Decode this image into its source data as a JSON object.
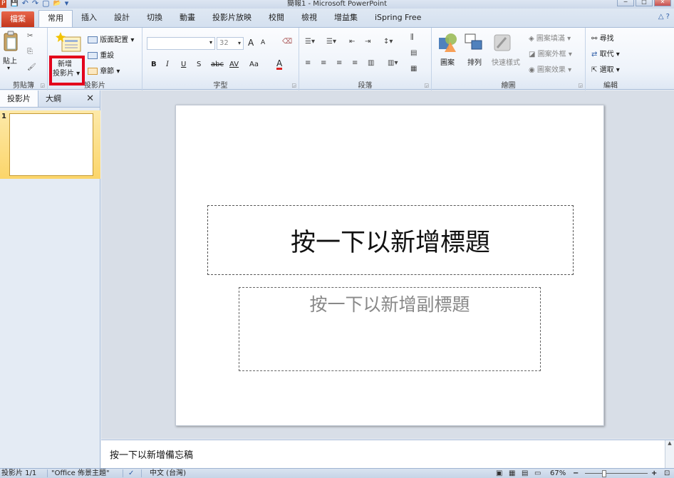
{
  "window": {
    "title": "簡報1 - Microsoft PowerPoint",
    "controls": [
      "─",
      "□",
      "✕"
    ]
  },
  "quick_access": [
    "P",
    "💾",
    "↶",
    "↷",
    "▢",
    "📂",
    "▾"
  ],
  "tabs": [
    "檔案",
    "常用",
    "插入",
    "設計",
    "切換",
    "動畫",
    "投影片放映",
    "校閱",
    "檢視",
    "增益集",
    "iSpring Free"
  ],
  "help_icon": "△ ?",
  "ribbon": {
    "clipboard": {
      "label": "剪貼簿",
      "paste": "貼上",
      "cut": "✂",
      "copy": "⎘",
      "format": "🖌"
    },
    "slides": {
      "label": "投影片",
      "new_slide_line1": "新增",
      "new_slide_line2": "投影片 ▾",
      "layout": "版面配置 ▾",
      "reset": "重設",
      "section": "章節 ▾"
    },
    "font": {
      "label": "字型",
      "font_size": "32",
      "bold": "B",
      "italic": "I",
      "underline": "U",
      "strike": "S",
      "abc": "abc",
      "spacing": "AV",
      "case": "Aa",
      "color": "A",
      "grow": "A",
      "shrink": "A",
      "clear": "⌫"
    },
    "paragraph": {
      "label": "段落"
    },
    "drawing": {
      "label": "繪圖",
      "shapes": "圖案",
      "arrange": "排列",
      "quick_styles": "快速樣式",
      "fill": "圖案填滿 ▾",
      "outline": "圖案外框 ▾",
      "effects": "圖案效果 ▾"
    },
    "editing": {
      "label": "編輯",
      "find": "尋找",
      "replace": "取代 ▾",
      "select": "選取 ▾"
    }
  },
  "panel": {
    "tab_slides": "投影片",
    "tab_outline": "大綱",
    "close": "✕",
    "slide_number": "1"
  },
  "slide": {
    "title_placeholder": "按一下以新增標題",
    "subtitle_placeholder": "按一下以新增副標題"
  },
  "notes": {
    "placeholder": "按一下以新增備忘稿"
  },
  "status": {
    "slide_count": "投影片 1/1",
    "theme": "\"Office 佈景主題\"",
    "language": "中文 (台灣)",
    "zoom": "67%",
    "zoom_out": "−",
    "zoom_in": "+"
  },
  "colors": {
    "file_tab": "#d24726",
    "accent": "#2f5ea8",
    "highlight": "#e3001b"
  }
}
